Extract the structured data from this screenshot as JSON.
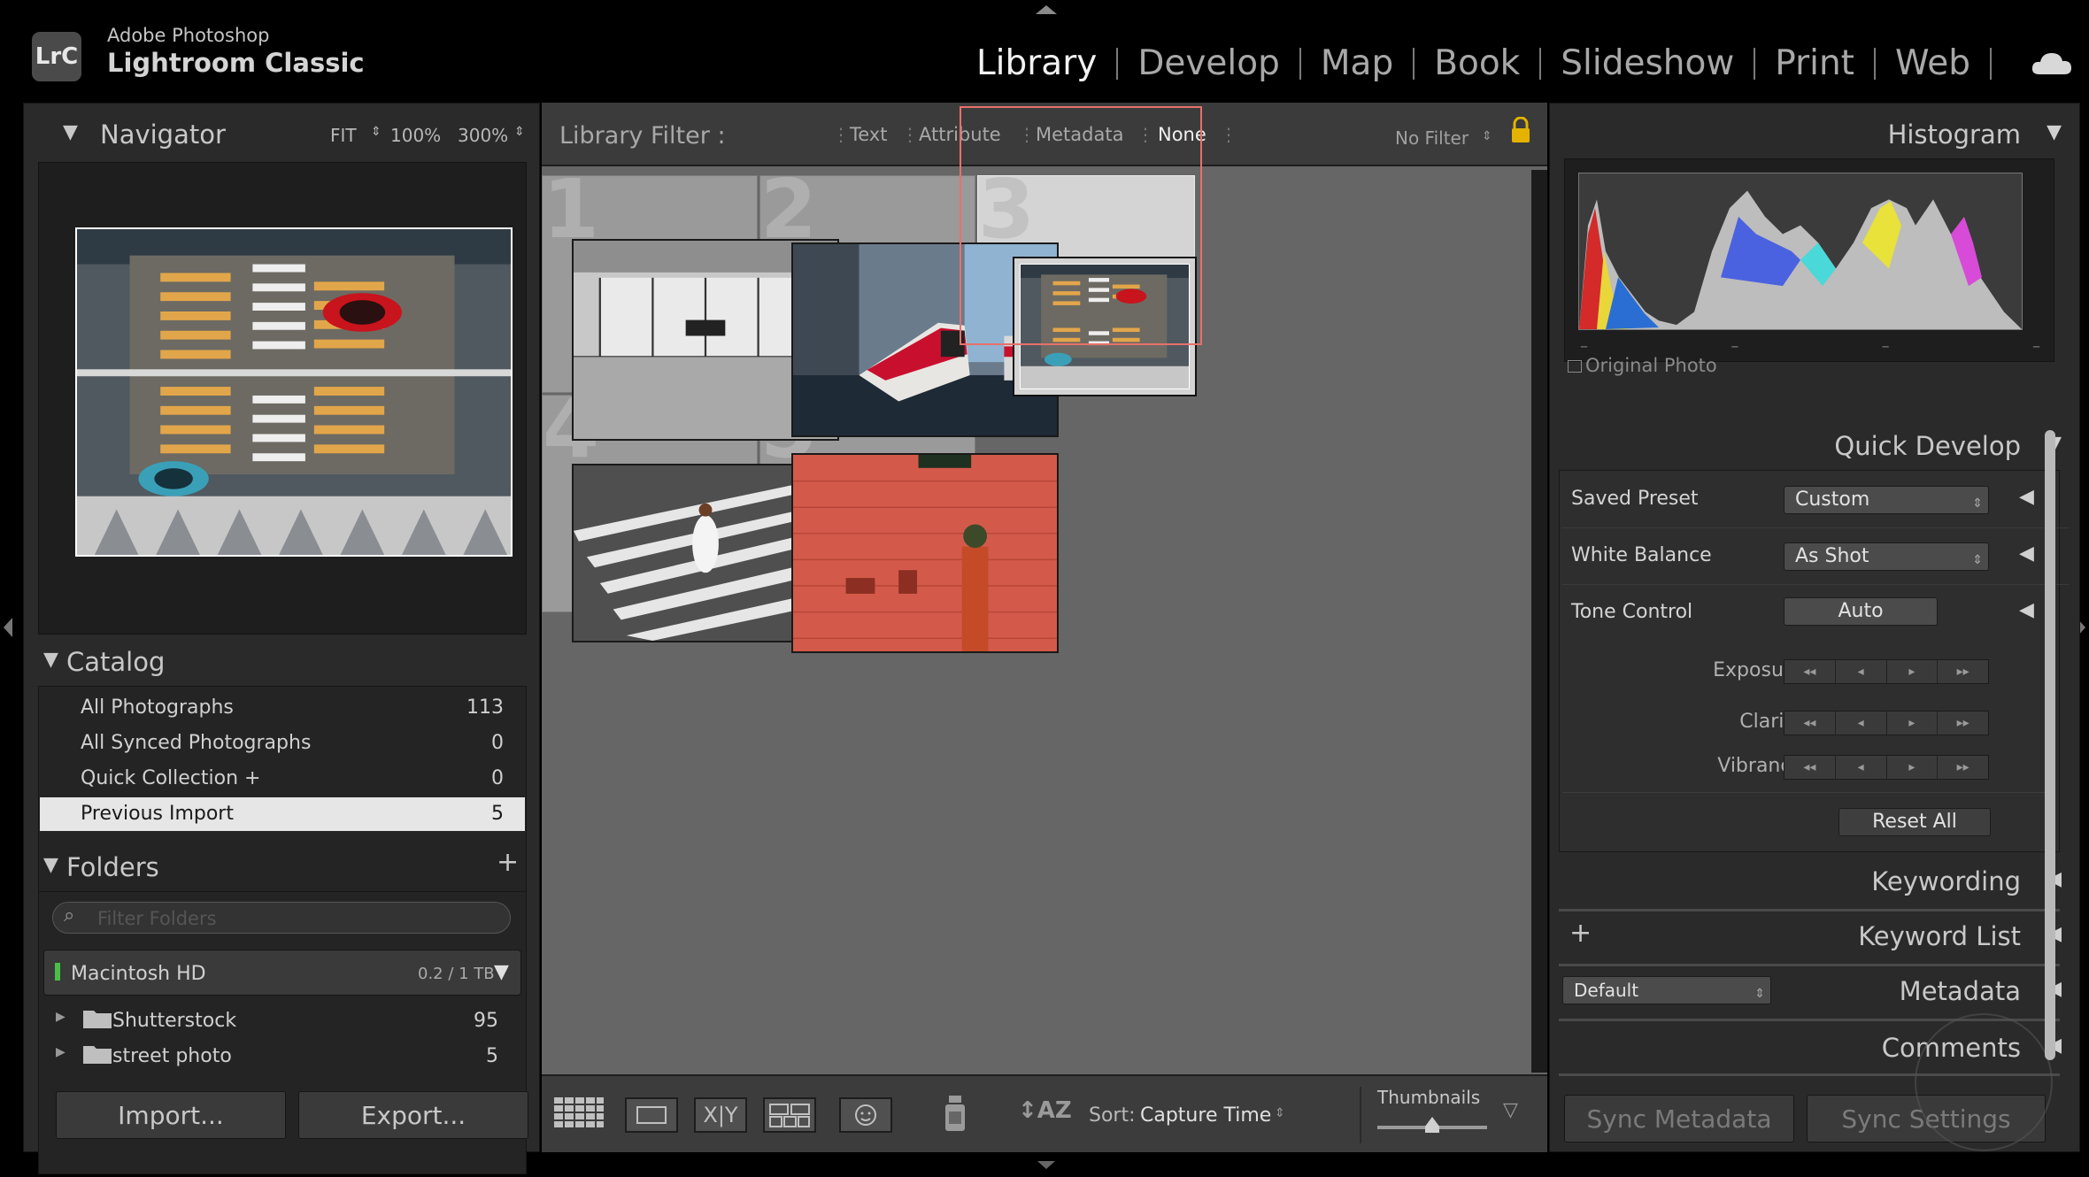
{
  "app": {
    "logo": "LrC",
    "vendor": "Adobe Photoshop",
    "name": "Lightroom Classic"
  },
  "modules": [
    "Library",
    "Develop",
    "Map",
    "Book",
    "Slideshow",
    "Print",
    "Web"
  ],
  "active_module": "Library",
  "navigator": {
    "title": "Navigator",
    "zoom": [
      "FIT",
      "100%",
      "300%"
    ]
  },
  "catalog": {
    "title": "Catalog",
    "items": [
      {
        "label": "All Photographs",
        "count": "113"
      },
      {
        "label": "All Synced Photographs",
        "count": "0"
      },
      {
        "label": "Quick Collection  +",
        "count": "0"
      },
      {
        "label": "Previous Import",
        "count": "5"
      }
    ]
  },
  "folders": {
    "title": "Folders",
    "filter_placeholder": "Filter Folders",
    "volume": {
      "label": "Macintosh HD",
      "size": "0.2 / 1 TB"
    },
    "items": [
      {
        "label": "Shutterstock",
        "count": "95"
      },
      {
        "label": "street photo",
        "count": "5"
      }
    ]
  },
  "bottom_left": {
    "import": "Import...",
    "export": "Export..."
  },
  "library_filter": {
    "label": "Library Filter :",
    "options": [
      "Text",
      "Attribute",
      "Metadata",
      "None"
    ],
    "active": "None",
    "preset": "No Filter"
  },
  "grid": {
    "cells": [
      {
        "number": "1",
        "subject": "glass storefront interior"
      },
      {
        "number": "2",
        "subject": "red and white streetcar"
      },
      {
        "number": "3",
        "subject": "aerial crosswalk with cars"
      },
      {
        "number": "4",
        "subject": "person walking on crosswalk"
      },
      {
        "number": "5",
        "subject": "person by red brick wall"
      }
    ],
    "selected": "3"
  },
  "toolbar": {
    "sort_label": "Sort:",
    "sort_value": "Capture Time",
    "thumbnails_label": "Thumbnails",
    "thumbnail_size": 0.5
  },
  "histogram": {
    "title": "Histogram",
    "original_photo": "Original Photo"
  },
  "quick_develop": {
    "title": "Quick Develop",
    "saved_preset_label": "Saved Preset",
    "saved_preset_value": "Custom",
    "white_balance_label": "White Balance",
    "white_balance_value": "As Shot",
    "tone_control_label": "Tone Control",
    "tone_control_button": "Auto",
    "exposure_label": "Exposure",
    "clarity_label": "Clarity",
    "vibrance_label": "Vibrance",
    "reset_all": "Reset All"
  },
  "right_panels": {
    "keywording": "Keywording",
    "keyword_list": "Keyword List",
    "metadata": "Metadata",
    "metadata_preset": "Default",
    "comments": "Comments"
  },
  "sync": {
    "metadata": "Sync Metadata",
    "settings": "Sync Settings"
  },
  "colors": {
    "selection_outline": "#e8706c",
    "panel_bg": "#2a2a2a",
    "grid_bg": "#666666"
  }
}
